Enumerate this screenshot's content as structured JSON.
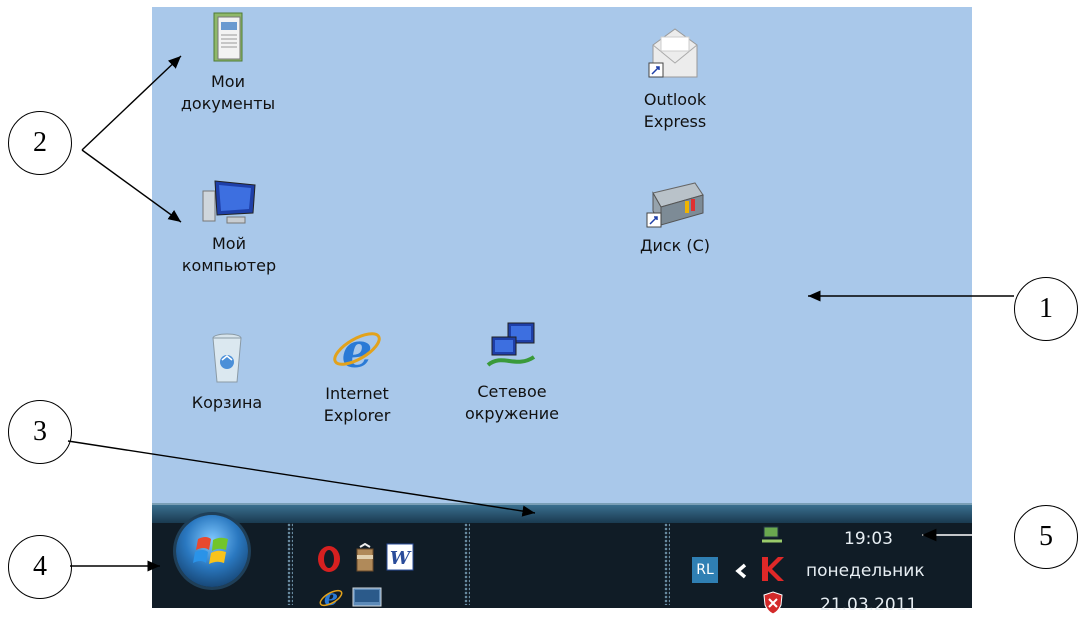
{
  "desktop": {
    "icons": [
      {
        "label": "Мои\nдокументы",
        "icon": "my-documents-icon"
      },
      {
        "label": "Мой\nкомпьютер",
        "icon": "my-computer-icon"
      },
      {
        "label": "Корзина",
        "icon": "recycle-bin-icon"
      },
      {
        "label": "Internet\nExplorer",
        "icon": "internet-explorer-icon"
      },
      {
        "label": "Сетевое\nокружение",
        "icon": "network-places-icon"
      },
      {
        "label": "Outlook\nExpress",
        "icon": "outlook-express-icon"
      },
      {
        "label": "Диск (С)",
        "icon": "disk-drive-icon"
      }
    ]
  },
  "taskbar": {
    "quick_launch": [
      "opera-icon",
      "archive-icon",
      "word-icon",
      "internet-explorer-icon",
      "show-desktop-icon"
    ],
    "tray": {
      "lang": "RL",
      "time": "19:03",
      "day": "понедельник",
      "date": "21.03.2011"
    }
  },
  "callouts": {
    "c1": "1",
    "c2": "2",
    "c3": "3",
    "c4": "4",
    "c5": "5"
  },
  "colors": {
    "desktop_bg": "#a9c8ea",
    "taskbar_bg": "#101c26"
  }
}
